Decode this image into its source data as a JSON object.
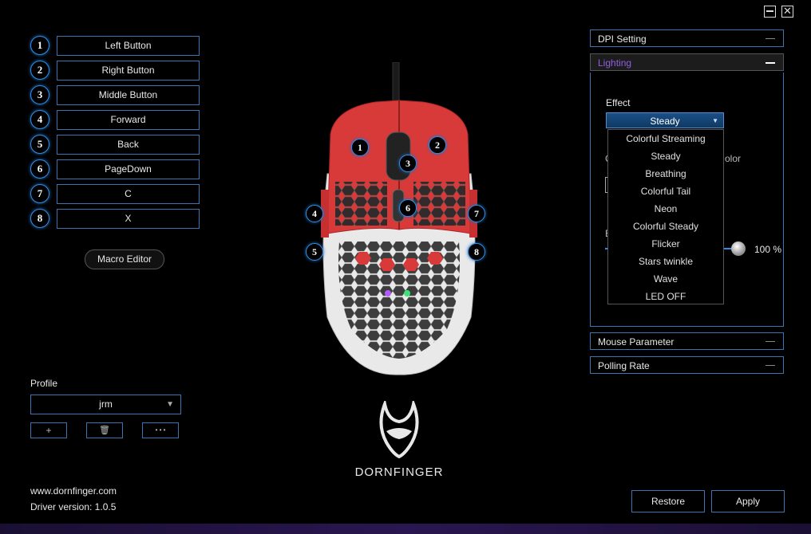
{
  "window": {
    "minimize_icon": "minimize-icon",
    "close_icon": "close-icon",
    "close_glyph": "✕"
  },
  "buttons": [
    {
      "num": "1",
      "label": "Left Button"
    },
    {
      "num": "2",
      "label": "Right Button"
    },
    {
      "num": "3",
      "label": "Middle Button"
    },
    {
      "num": "4",
      "label": "Forward"
    },
    {
      "num": "5",
      "label": "Back"
    },
    {
      "num": "6",
      "label": "PageDown"
    },
    {
      "num": "7",
      "label": "C"
    },
    {
      "num": "8",
      "label": "X"
    }
  ],
  "macro_editor": "Macro Editor",
  "profile": {
    "label": "Profile",
    "selected": "jrm",
    "add_glyph": "+",
    "delete_glyph": "🗑",
    "more_glyph": "• • •"
  },
  "footer": {
    "website": "www.dornfinger.com",
    "driver_version": "Driver version: 1.0.5"
  },
  "brand": {
    "name": "DORNFINGER"
  },
  "mouse_markers": [
    "1",
    "2",
    "3",
    "4",
    "5",
    "6",
    "7",
    "8"
  ],
  "panels": {
    "dpi": "DPI Setting",
    "lighting": "Lighting",
    "mouse_parameter": "Mouse Parameter",
    "polling_rate": "Polling Rate"
  },
  "lighting": {
    "effect_label": "Effect",
    "effect_selected": "Steady",
    "partial_color_label": "olor",
    "partial_c": "C",
    "partial_b": "B",
    "brightness_value": "100 %",
    "options": [
      "Colorful Streaming",
      "Steady",
      "Breathing",
      "Colorful Tail",
      "Neon",
      "Colorful Steady",
      "Flicker",
      "Stars twinkle",
      "Wave",
      "LED OFF"
    ]
  },
  "actions": {
    "restore": "Restore",
    "apply": "Apply"
  },
  "colors": {
    "accent_blue": "#3b74b0",
    "lighting_active": "#8e5fe0",
    "mouse_red": "#d83a3a"
  }
}
